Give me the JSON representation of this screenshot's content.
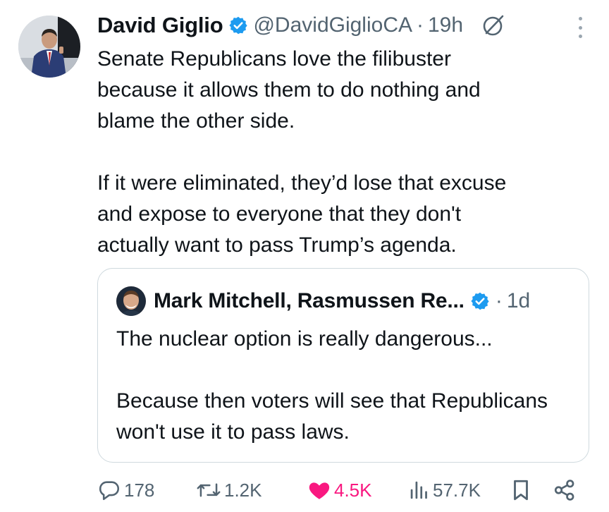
{
  "tweet": {
    "author_name": "David Giglio",
    "handle": "@DavidGiglioCA",
    "separator": "·",
    "time": "19h",
    "paragraphs": [
      "Senate Republicans love the filibuster\nbecause it allows them to do nothing and\nblame the other side.",
      "If it were eliminated, they’d lose that excuse\nand expose to everyone that they don't\nactually want to pass Trump’s agenda."
    ]
  },
  "quote": {
    "author_name": "Mark Mitchell, Rasmussen Re...",
    "separator": "·",
    "time": "1d",
    "paragraphs": [
      "The nuclear option is really dangerous...",
      "Because then voters will see that Republicans won't use it to pass laws."
    ]
  },
  "actions": {
    "replies": "178",
    "reposts": "1.2K",
    "likes": "4.5K",
    "views": "57.7K"
  },
  "colors": {
    "verified": "#1d9bf0",
    "like": "#f91880",
    "muted": "#536471",
    "border": "#cfd9de"
  },
  "icons": [
    "verified-badge-icon",
    "grok-icon",
    "more-options-icon",
    "reply-icon",
    "repost-icon",
    "heart-icon",
    "views-icon",
    "bookmark-icon",
    "share-icon"
  ]
}
